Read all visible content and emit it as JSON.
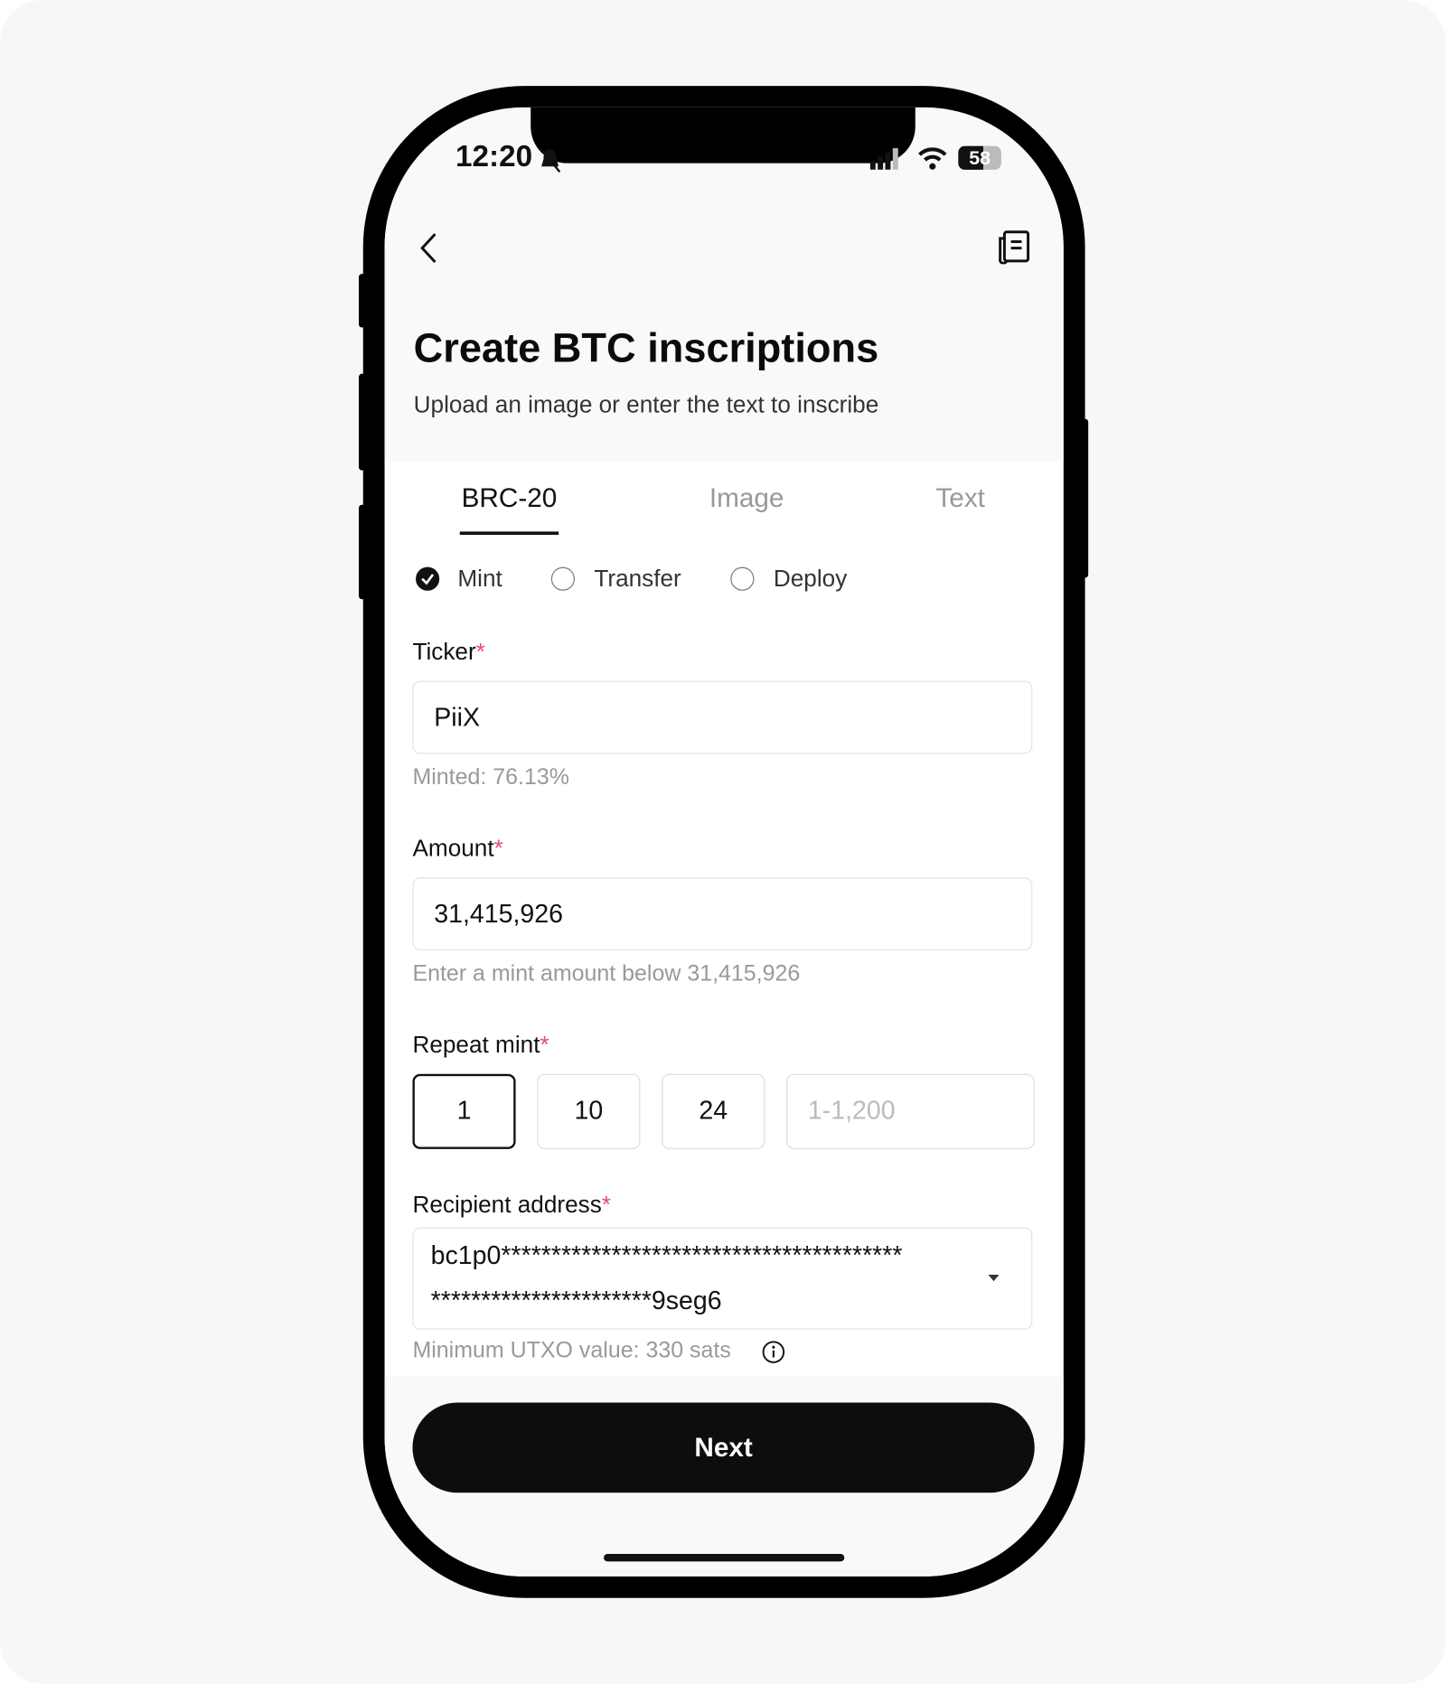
{
  "status": {
    "time": "12:20",
    "battery": "58"
  },
  "header": {
    "title": "Create BTC inscriptions",
    "subtitle": "Upload an image or enter the text to inscribe"
  },
  "tabs": [
    {
      "label": "BRC-20",
      "active": true
    },
    {
      "label": "Image"
    },
    {
      "label": "Text"
    }
  ],
  "operations": [
    {
      "label": "Mint",
      "checked": true
    },
    {
      "label": "Transfer"
    },
    {
      "label": "Deploy"
    }
  ],
  "ticker": {
    "label": "Ticker",
    "required": "*",
    "value": "PiiX",
    "helper": "Minted: 76.13%"
  },
  "amount": {
    "label": "Amount",
    "required": "*",
    "value": "31,415,926",
    "helper": "Enter a mint amount below 31,415,926"
  },
  "repeat": {
    "label": "Repeat mint",
    "required": "*",
    "options": [
      "1",
      "10",
      "24"
    ],
    "selected": "1",
    "placeholder": "1-1,200"
  },
  "recipient": {
    "label": "Recipient address",
    "required": "*",
    "line1": "bc1p0****************************************",
    "line2": "**********************9seg6",
    "helper": "Minimum UTXO value: 330 sats"
  },
  "next_label": "Next",
  "colors": {
    "accent": "#0d0d0d",
    "required": "#e84a6a",
    "helper": "#999999"
  }
}
